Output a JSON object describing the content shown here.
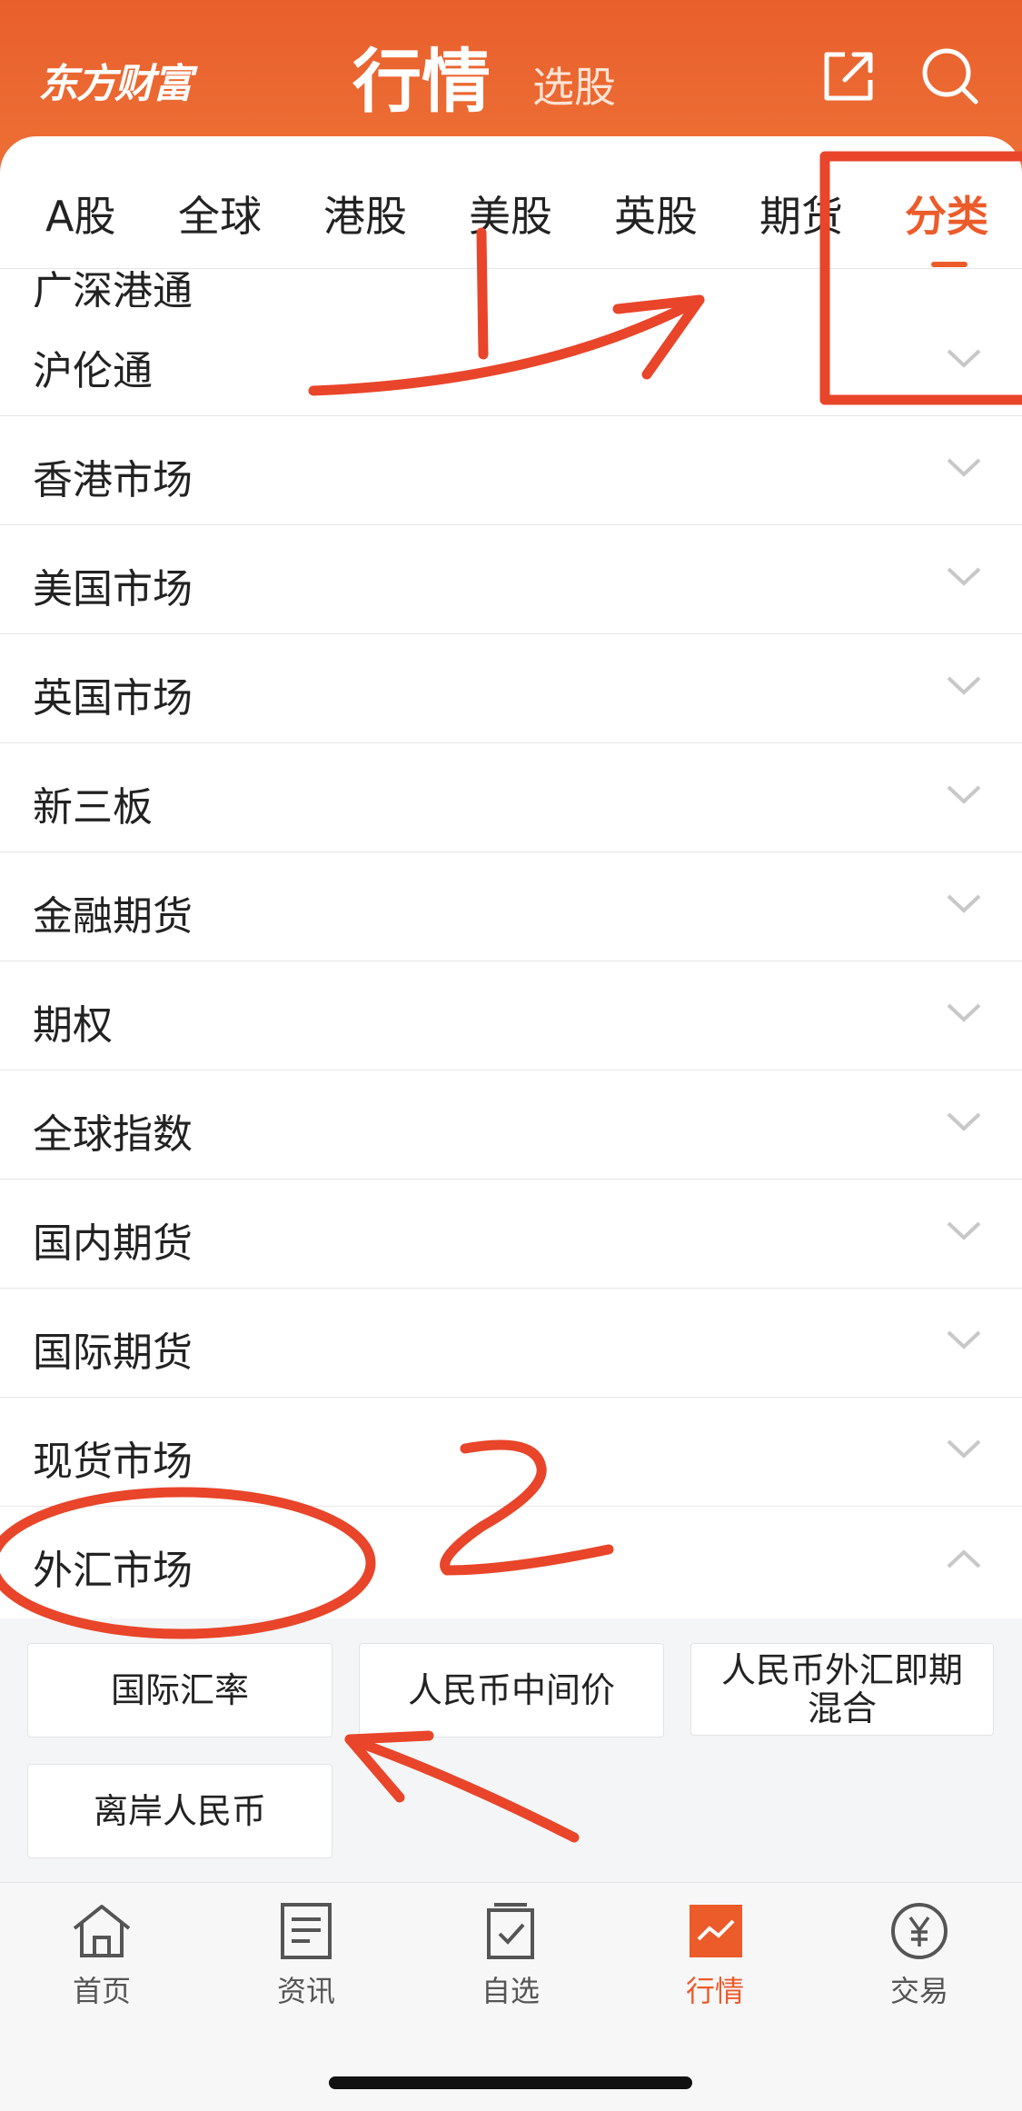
{
  "header": {
    "logo": "东方财富",
    "title": "行情",
    "subtitle": "选股"
  },
  "tabs": [
    {
      "label": "A股",
      "active": false
    },
    {
      "label": "全球",
      "active": false
    },
    {
      "label": "港股",
      "active": false
    },
    {
      "label": "美股",
      "active": false
    },
    {
      "label": "英股",
      "active": false
    },
    {
      "label": "期货",
      "active": false
    },
    {
      "label": "分类",
      "active": true
    }
  ],
  "list": {
    "partial_item": "广深港通",
    "items": [
      {
        "label": "沪伦通",
        "expanded": false
      },
      {
        "label": "香港市场",
        "expanded": false
      },
      {
        "label": "美国市场",
        "expanded": false
      },
      {
        "label": "英国市场",
        "expanded": false
      },
      {
        "label": "新三板",
        "expanded": false
      },
      {
        "label": "金融期货",
        "expanded": false
      },
      {
        "label": "期权",
        "expanded": false
      },
      {
        "label": "全球指数",
        "expanded": false
      },
      {
        "label": "国内期货",
        "expanded": false
      },
      {
        "label": "国际期货",
        "expanded": false
      },
      {
        "label": "现货市场",
        "expanded": false
      },
      {
        "label": "外汇市场",
        "expanded": true
      }
    ]
  },
  "forex_options": [
    "国际汇率",
    "人民币中间价",
    "人民币外汇即期混合",
    "离岸人民币"
  ],
  "bottom_nav": [
    {
      "label": "首页",
      "icon": "home-icon",
      "active": false
    },
    {
      "label": "资讯",
      "icon": "news-icon",
      "active": false
    },
    {
      "label": "自选",
      "icon": "watchlist-icon",
      "active": false
    },
    {
      "label": "行情",
      "icon": "market-icon",
      "active": true
    },
    {
      "label": "交易",
      "icon": "trade-icon",
      "active": false
    }
  ],
  "annotation": {
    "step_number": "2"
  },
  "colors": {
    "accent": "#ec5b2a",
    "header_top": "#e95f2c",
    "header_bottom": "#ef7a3c",
    "annotation_red": "#e8452a"
  }
}
